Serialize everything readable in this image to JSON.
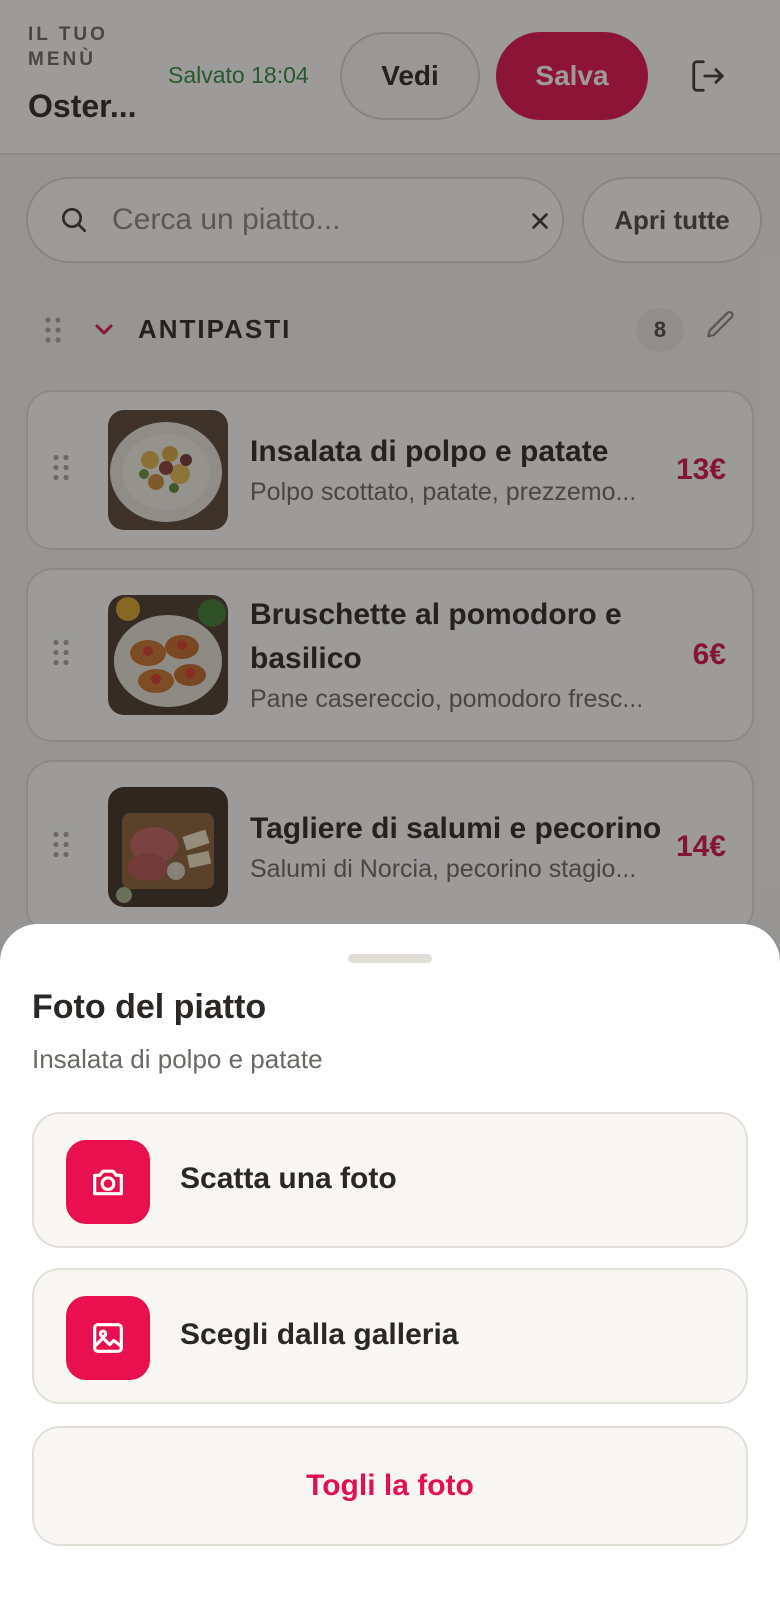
{
  "header": {
    "kicker": "IL TUO MENÙ",
    "restaurant_name": "Oster...",
    "saved_status": "Salvato 18:04",
    "view_label": "Vedi",
    "save_label": "Salva",
    "logout_icon": "logout-icon"
  },
  "search": {
    "placeholder": "Cerca un piatto...",
    "value": "",
    "open_all_label": "Apri tutte"
  },
  "category": {
    "title": "ANTIPASTI",
    "count": "8",
    "expanded": true
  },
  "dishes": [
    {
      "name": "Insalata di polpo e patate",
      "description": "Polpo scottato, patate, prezzemo...",
      "price": "13€"
    },
    {
      "name": "Bruschette al pomodoro e basilico",
      "description": "Pane casereccio, pomodoro fresc...",
      "price": "6€"
    },
    {
      "name": "Tagliere di salumi e pecorino",
      "description": "Salumi di Norcia, pecorino stagio...",
      "price": "14€"
    }
  ],
  "sheet": {
    "title": "Foto del piatto",
    "subtitle": "Insalata di polpo e patate",
    "take_photo_label": "Scatta una foto",
    "gallery_label": "Scegli dalla galleria",
    "remove_label": "Togli la foto"
  },
  "colors": {
    "accent": "#e3104f",
    "saved_green": "#2f8a3e",
    "price": "#d8104c"
  }
}
